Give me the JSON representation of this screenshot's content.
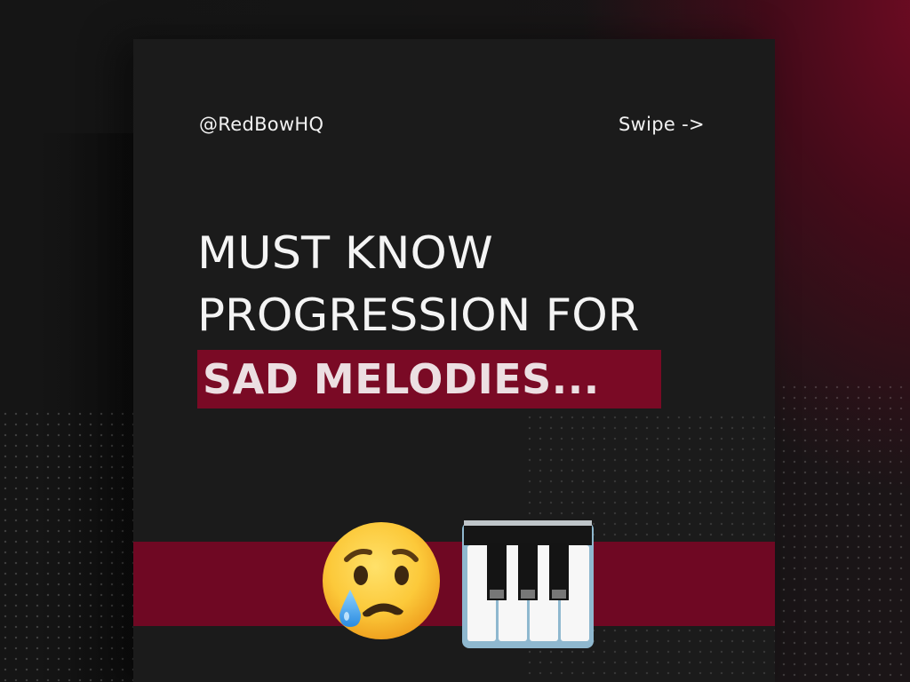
{
  "header": {
    "handle": "@RedBowHQ",
    "swipe": "Swipe ->"
  },
  "headline": {
    "line1": "MUST KNOW",
    "line2": "PROGRESSION FOR",
    "line3": "SAD MELODIES..."
  },
  "icons": {
    "crying_face": "crying-face-icon",
    "piano": "piano-keys-icon"
  },
  "colors": {
    "background": "#151515",
    "card": "#1b1b1b",
    "accent": "#7a0a25",
    "text": "#f4f4f4"
  }
}
